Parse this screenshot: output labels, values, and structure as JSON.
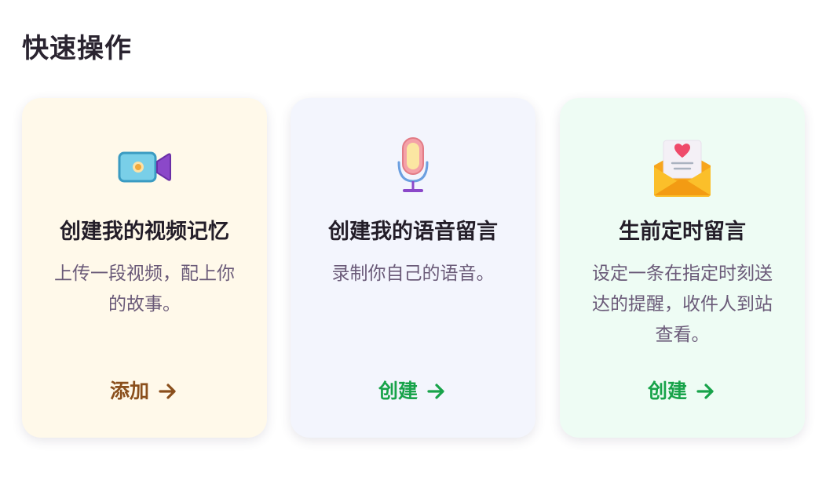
{
  "section": {
    "title": "快速操作"
  },
  "cards": [
    {
      "icon": "video-camera-icon",
      "title": "创建我的视频记忆",
      "description": "上传一段视频，配上你的故事。",
      "action_label": "添加",
      "action_color": "#8a4f1c",
      "background": "#fff9ea"
    },
    {
      "icon": "microphone-icon",
      "title": "创建我的语音留言",
      "description": "录制你自己的语音。",
      "action_label": "创建",
      "action_color": "#18a34a",
      "background": "#f3f5fd"
    },
    {
      "icon": "love-letter-icon",
      "title": "生前定时留言",
      "description": "设定一条在指定时刻送达的提醒，收件人到站查看。",
      "action_label": "创建",
      "action_color": "#18a34a",
      "background": "#eefcf4"
    }
  ]
}
